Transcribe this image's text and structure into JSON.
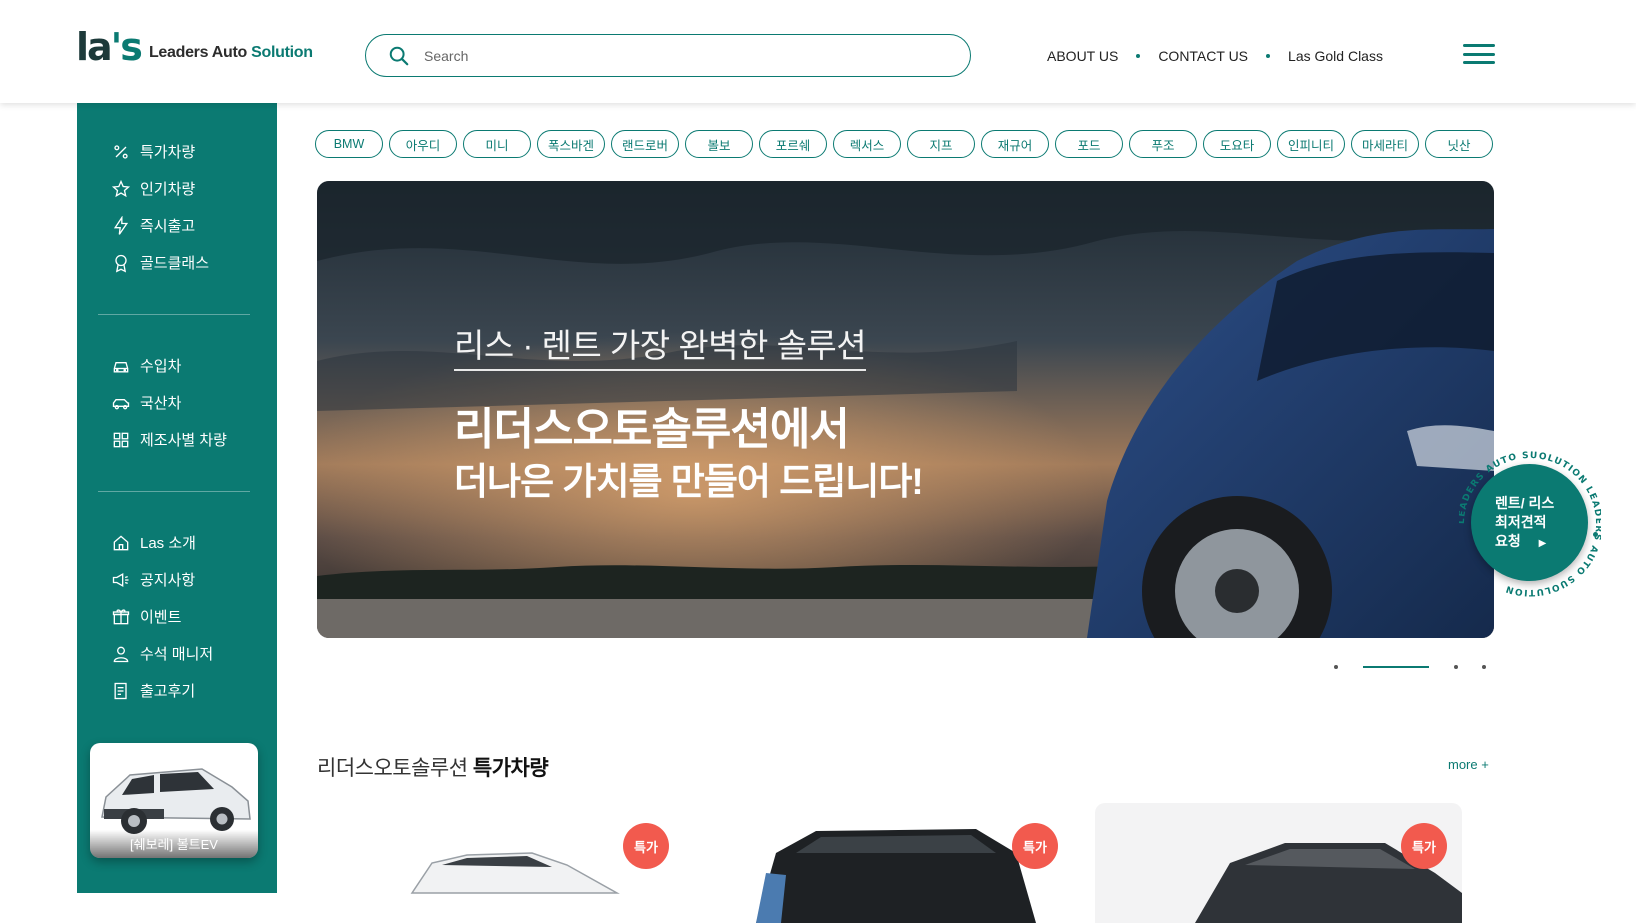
{
  "header": {
    "logo_mark": "la",
    "logo_apos": "'s",
    "logo_text": "Leaders Auto",
    "logo_text_accent": "Solution",
    "search_placeholder": "Search",
    "nav": [
      "ABOUT US",
      "CONTACT US",
      "Las Gold Class"
    ]
  },
  "sidebar": {
    "group1": [
      {
        "label": "특가차량",
        "icon": "percent-icon"
      },
      {
        "label": "인기차량",
        "icon": "star-icon"
      },
      {
        "label": "즉시출고",
        "icon": "lightning-icon"
      },
      {
        "label": "골드클래스",
        "icon": "award-icon"
      }
    ],
    "group2": [
      {
        "label": "수입차",
        "icon": "car-front-icon"
      },
      {
        "label": "국산차",
        "icon": "car-side-icon"
      },
      {
        "label": "제조사별 차량",
        "icon": "grid-icon"
      }
    ],
    "group3": [
      {
        "label": "Las 소개",
        "icon": "home-icon"
      },
      {
        "label": "공지사항",
        "icon": "megaphone-icon"
      },
      {
        "label": "이벤트",
        "icon": "gift-icon"
      },
      {
        "label": "수석 매니저",
        "icon": "person-icon"
      },
      {
        "label": "출고후기",
        "icon": "document-icon"
      }
    ],
    "promo_card": {
      "caption": "[쉐보레] 볼트EV"
    }
  },
  "brands": [
    "BMW",
    "아우디",
    "미니",
    "폭스바겐",
    "랜드로버",
    "볼보",
    "포르쉐",
    "렉서스",
    "지프",
    "재규어",
    "포드",
    "푸조",
    "도요타",
    "인피니티",
    "마세라티",
    "닛산"
  ],
  "hero": {
    "subtitle": "리스 · 렌트 가장 완벽한 솔루션",
    "title_line1": "리더스오토솔루션에서",
    "title_line2": "더나은 가치를 만들어 드립니다!"
  },
  "carousel": {
    "slides": 4,
    "active_index": 1
  },
  "float_badge": {
    "ring_text": "LEADERS AUTO SUOLUTION  LEADERS AUTO SUOLUTION  ",
    "line1": "렌트/ 리스",
    "line2": "최저견적",
    "line3": "요청"
  },
  "section": {
    "title_light": "리더스오토솔루션",
    "title_bold": "특가차량",
    "more_label": "more +",
    "cards": [
      {
        "badge": "특가"
      },
      {
        "badge": "특가"
      },
      {
        "badge": "특가"
      }
    ]
  },
  "colors": {
    "brand_teal": "#0b7a72",
    "badge_red": "#f25a4e"
  }
}
